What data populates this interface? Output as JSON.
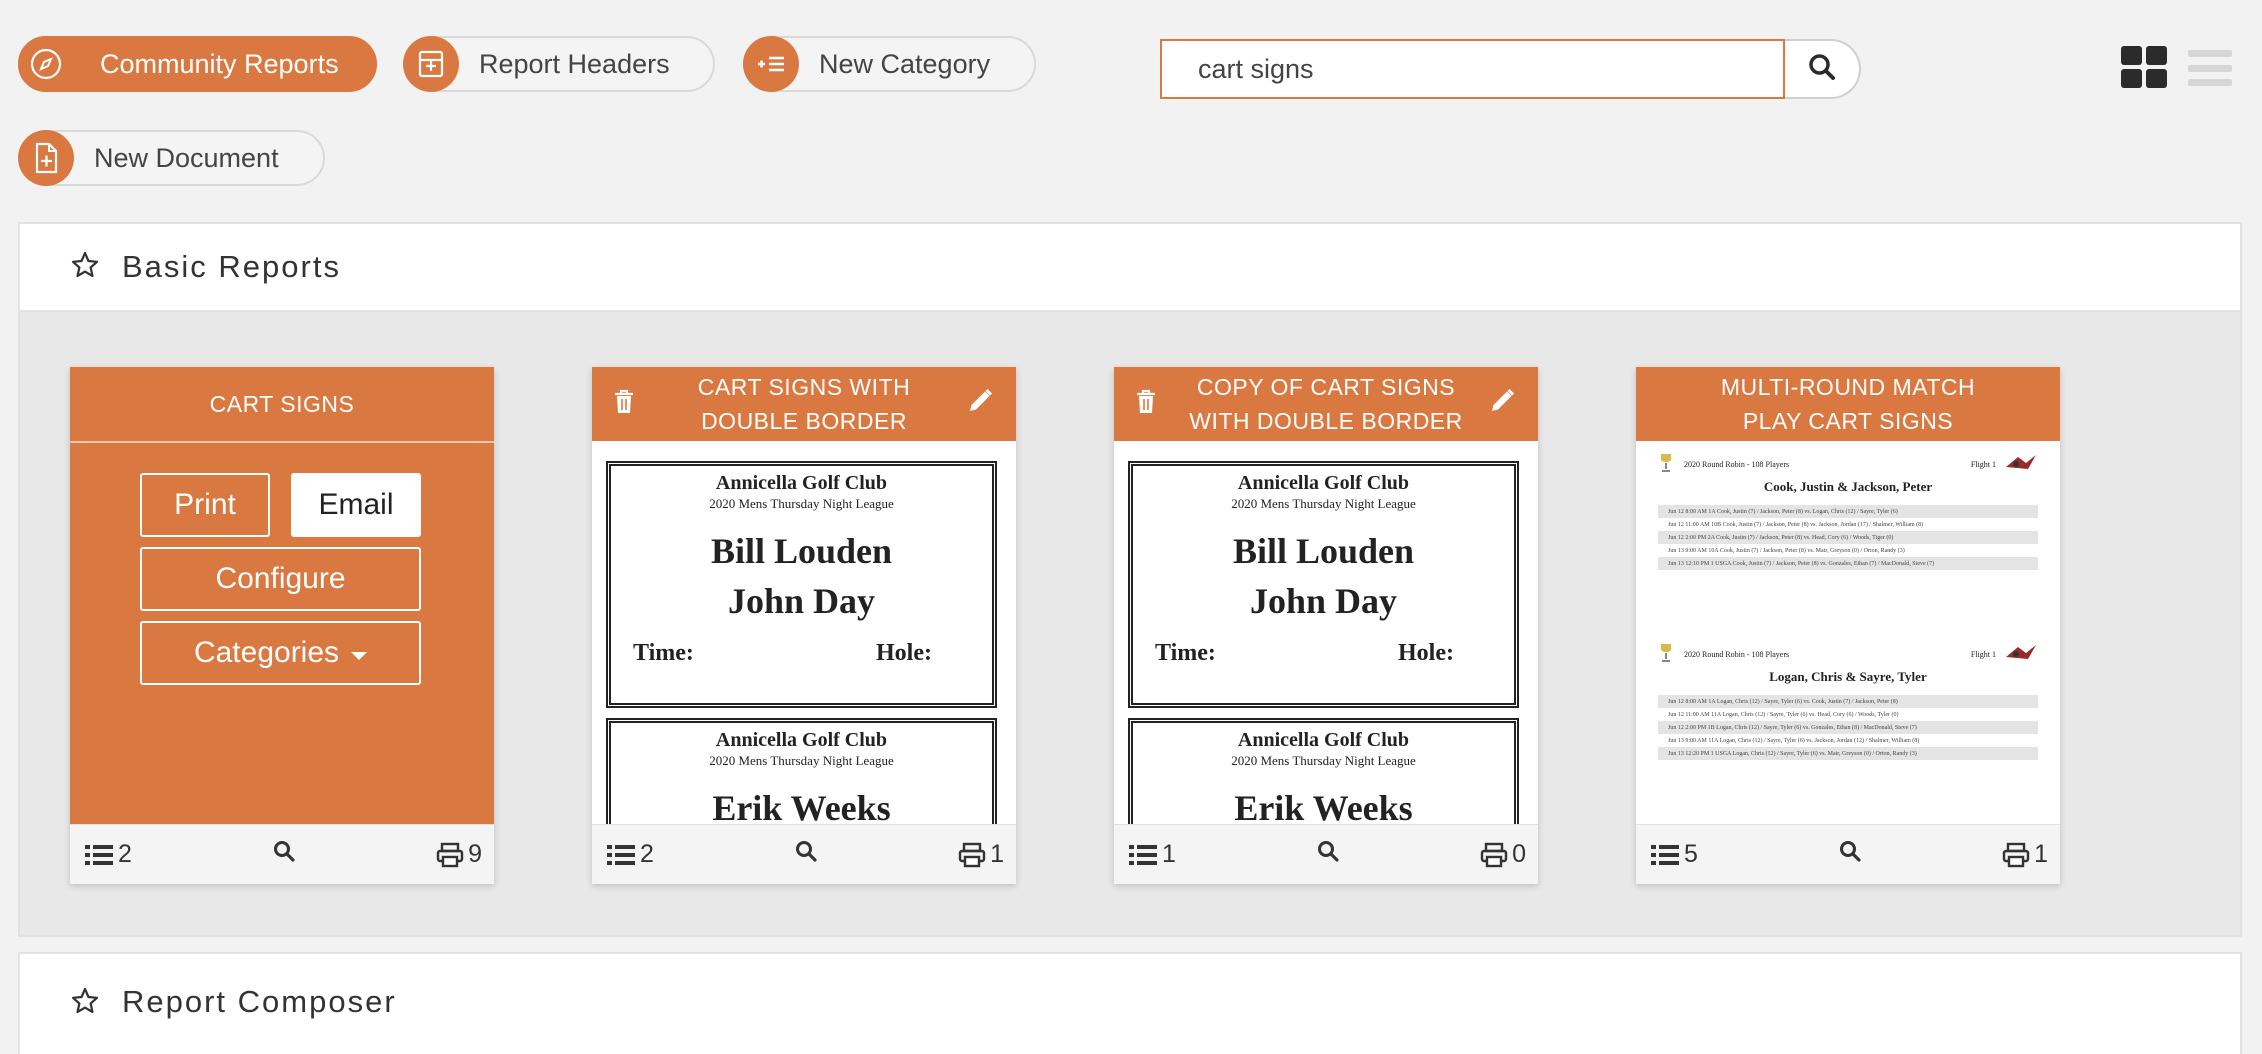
{
  "toolbar": {
    "community_reports": "Community Reports",
    "report_headers": "Report Headers",
    "new_category": "New Category",
    "new_document": "New Document"
  },
  "search": {
    "value": "cart signs",
    "placeholder": ""
  },
  "sections": {
    "basic": "Basic Reports",
    "composer": "Report Composer"
  },
  "cards": [
    {
      "title": "CART SIGNS",
      "buttons": {
        "print": "Print",
        "email": "Email",
        "configure": "Configure",
        "categories": "Categories"
      },
      "items": "2",
      "prints": "9"
    },
    {
      "title": "CART SIGNS WITH DOUBLE BORDER",
      "items": "2",
      "prints": "1"
    },
    {
      "title": "COPY OF CART SIGNS WITH DOUBLE BORDER",
      "items": "1",
      "prints": "0"
    },
    {
      "title": "MULTI-ROUND MATCH PLAY CART SIGNS",
      "items": "5",
      "prints": "1"
    }
  ],
  "preview_sign": {
    "club": "Annicella Golf Club",
    "league": "2020 Mens Thursday Night League",
    "name1": "Bill Louden",
    "name2": "John Day",
    "time": "Time:",
    "hole": "Hole:",
    "name3": "Erik Weeks"
  },
  "preview_match": {
    "header": "2020 Round Robin - 108 Players",
    "flight": "Flight 1",
    "title1": "Cook, Justin & Jackson, Peter",
    "title2": "Logan, Chris & Sayre, Tyler",
    "rows1": [
      "Jun 12   8:00 AM   1A        Cook, Justin (7) / Jackson, Peter (8)   vs.   Logan, Chris (12) / Sayre, Tyler (6)",
      "Jun 12   11:00 AM  10B       Cook, Justin (7) / Jackson, Peter (8)   vs.   Jackson, Jordan (17) / Shalmer, William (8)",
      "Jun 12   2:00 PM   2A        Cook, Justin (7) / Jackson, Peter (8)   vs.   Head, Cory (6) / Woods, Tiger (0)",
      "Jun 13   9:00 AM   10A       Cook, Justin (7) / Jackson, Peter (8)   vs.   Mair, Greyson (0) / Orton, Randy (3)",
      "Jun 13   12:10 PM  1   USGA  Cook, Justin (7) / Jackson, Peter (8)   vs.   Gonzales, Ethan (7) / MacDonald, Steve (7)"
    ],
    "rows2": [
      "Jun 12   8:00 AM   1A        Logan, Chris (12) / Sayre, Tyler (6)   vs.   Cook, Justin (7) / Jackson, Peter (8)",
      "Jun 12   11:00 AM  11A       Logan, Chris (12) / Sayre, Tyler (6)   vs.   Head, Cory (6) / Woods, Tyler (0)",
      "Jun 12   2:00 PM   1B        Logan, Chris (12) / Sayre, Tyler (6)   vs.   Gonzales, Ethan (8) / MacDonald, Steve (7)",
      "Jun 13   9:00 AM   11A       Logan, Chris (12) / Sayre, Tyler (6)   vs.   Jackson, Jordan (12) / Shalmer, William (8)",
      "Jun 13   12:20 PM  1   USGA  Logan, Chris (12) / Sayre, Tyler (6)   vs.   Mair, Greyson (0) / Orton, Randy (3)"
    ]
  },
  "colors": {
    "accent": "#d97941",
    "dark": "#2b2b2b"
  },
  "icons": [
    "compass-icon",
    "header-icon",
    "list-add-icon",
    "file-plus-icon",
    "search-icon",
    "grid-view-icon",
    "list-view-icon",
    "star-icon",
    "trash-icon",
    "pencil-icon",
    "list-icon",
    "printer-icon",
    "caret-down-icon",
    "trophy-icon"
  ]
}
